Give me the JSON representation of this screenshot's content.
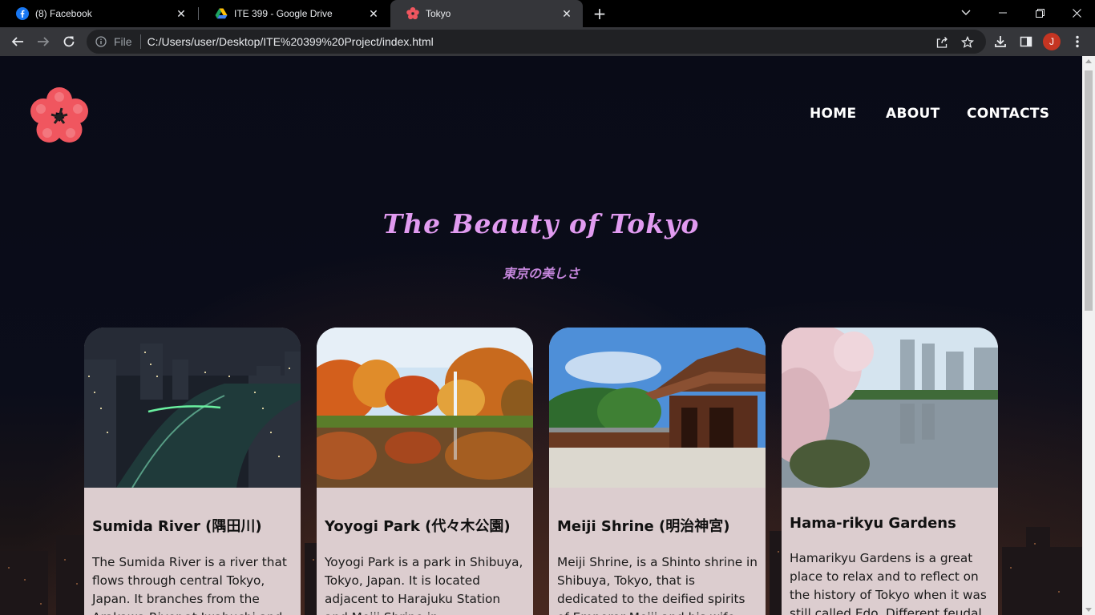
{
  "browser": {
    "tabs": [
      {
        "title": "(8) Facebook",
        "icon": "facebook-icon",
        "active": false
      },
      {
        "title": "ITE 399 - Google Drive",
        "icon": "google-drive-icon",
        "active": false
      },
      {
        "title": "Tokyo",
        "icon": "flower-icon",
        "active": true
      }
    ],
    "address": {
      "scheme": "File",
      "url": "C:/Users/user/Desktop/ITE%20399%20Project/index.html"
    },
    "profile_initial": "J"
  },
  "page": {
    "nav": {
      "home": "HOME",
      "about": "ABOUT",
      "contacts": "CONTACTS"
    },
    "hero": {
      "title": "The Beauty of Tokyo",
      "subtitle": "東京の美しさ"
    },
    "cards": [
      {
        "title": "Sumida River (隅田川)",
        "text": "The Sumida River is a river that flows through central Tokyo, Japan. It branches from the Arakawa River at Iwabuchi and"
      },
      {
        "title": "Yoyogi Park (代々木公園)",
        "text": "Yoyogi Park is a park in Shibuya, Tokyo, Japan. It is located adjacent to Harajuku Station and Meiji Shrine in"
      },
      {
        "title": "Meiji Shrine (明治神宮)",
        "text": "Meiji Shrine, is a Shinto shrine in Shibuya, Tokyo, that is dedicated to the deified spirits of Emperor Meiji and his wife"
      },
      {
        "title": "Hama-rikyu Gardens",
        "text": "Hamarikyu Gardens is a great place to relax and to reflect on the history of Tokyo when it was still called Edo. Different feudal"
      }
    ]
  },
  "colors": {
    "accent_title": "#e19bf0",
    "card_bg": "#dccdcf",
    "logo": "#f0565f"
  }
}
